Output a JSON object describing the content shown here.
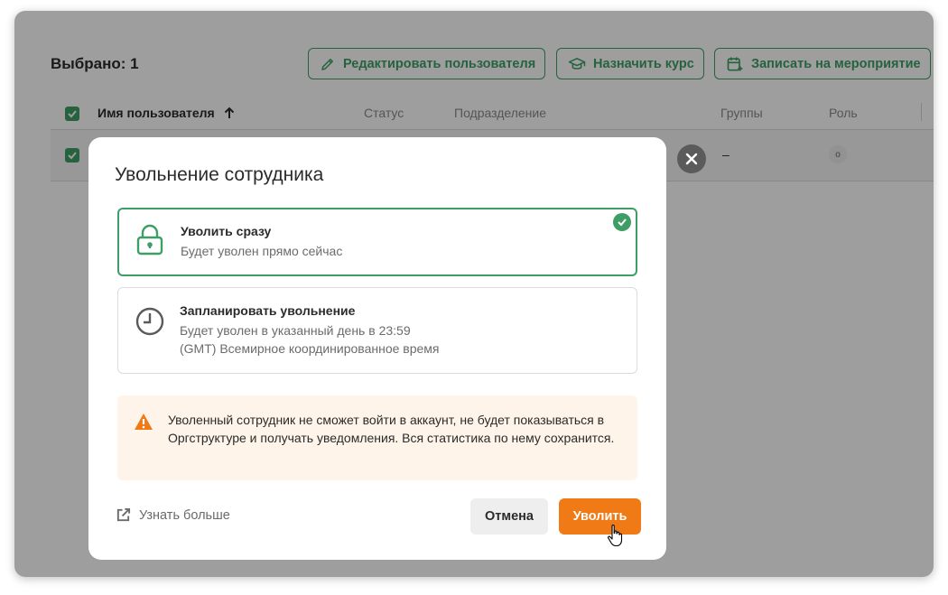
{
  "header": {
    "selected_label": "Выбрано: 1",
    "actions": [
      {
        "label": "Редактировать пользователя",
        "icon": "pencil-icon"
      },
      {
        "label": "Назначить курс",
        "icon": "graduation-cap-icon"
      },
      {
        "label": "Записать на мероприятие",
        "icon": "calendar-add-icon"
      }
    ]
  },
  "table": {
    "columns": [
      "Имя пользователя",
      "Статус",
      "Подразделение",
      "Группы",
      "Роль"
    ],
    "sort_indicator": "arrow-up-icon",
    "rows": [
      {
        "selected": true,
        "groups": "–",
        "role": "o"
      }
    ]
  },
  "modal": {
    "title": "Увольнение сотрудника",
    "options": [
      {
        "title": "Уволить сразу",
        "desc": "Будет уволен прямо сейчас",
        "icon": "lock-icon",
        "selected": true
      },
      {
        "title": "Запланировать увольнение",
        "desc_line1": "Будет уволен в указанный день в 23:59",
        "desc_line2": "(GMT) Всемирное координированное время",
        "icon": "clock-icon",
        "selected": false
      }
    ],
    "warning": "Уволенный сотрудник не сможет войти в аккаунт, не будет показываться в Оргструктуре и получать уведомления. Вся статистика по нему сохранится.",
    "learn_more": "Узнать больше",
    "cancel_label": "Отмена",
    "confirm_label": "Уволить"
  },
  "colors": {
    "accent_green": "#3f9e66",
    "confirm_orange": "#ef7a16",
    "warning_bg": "#fef4e9"
  }
}
